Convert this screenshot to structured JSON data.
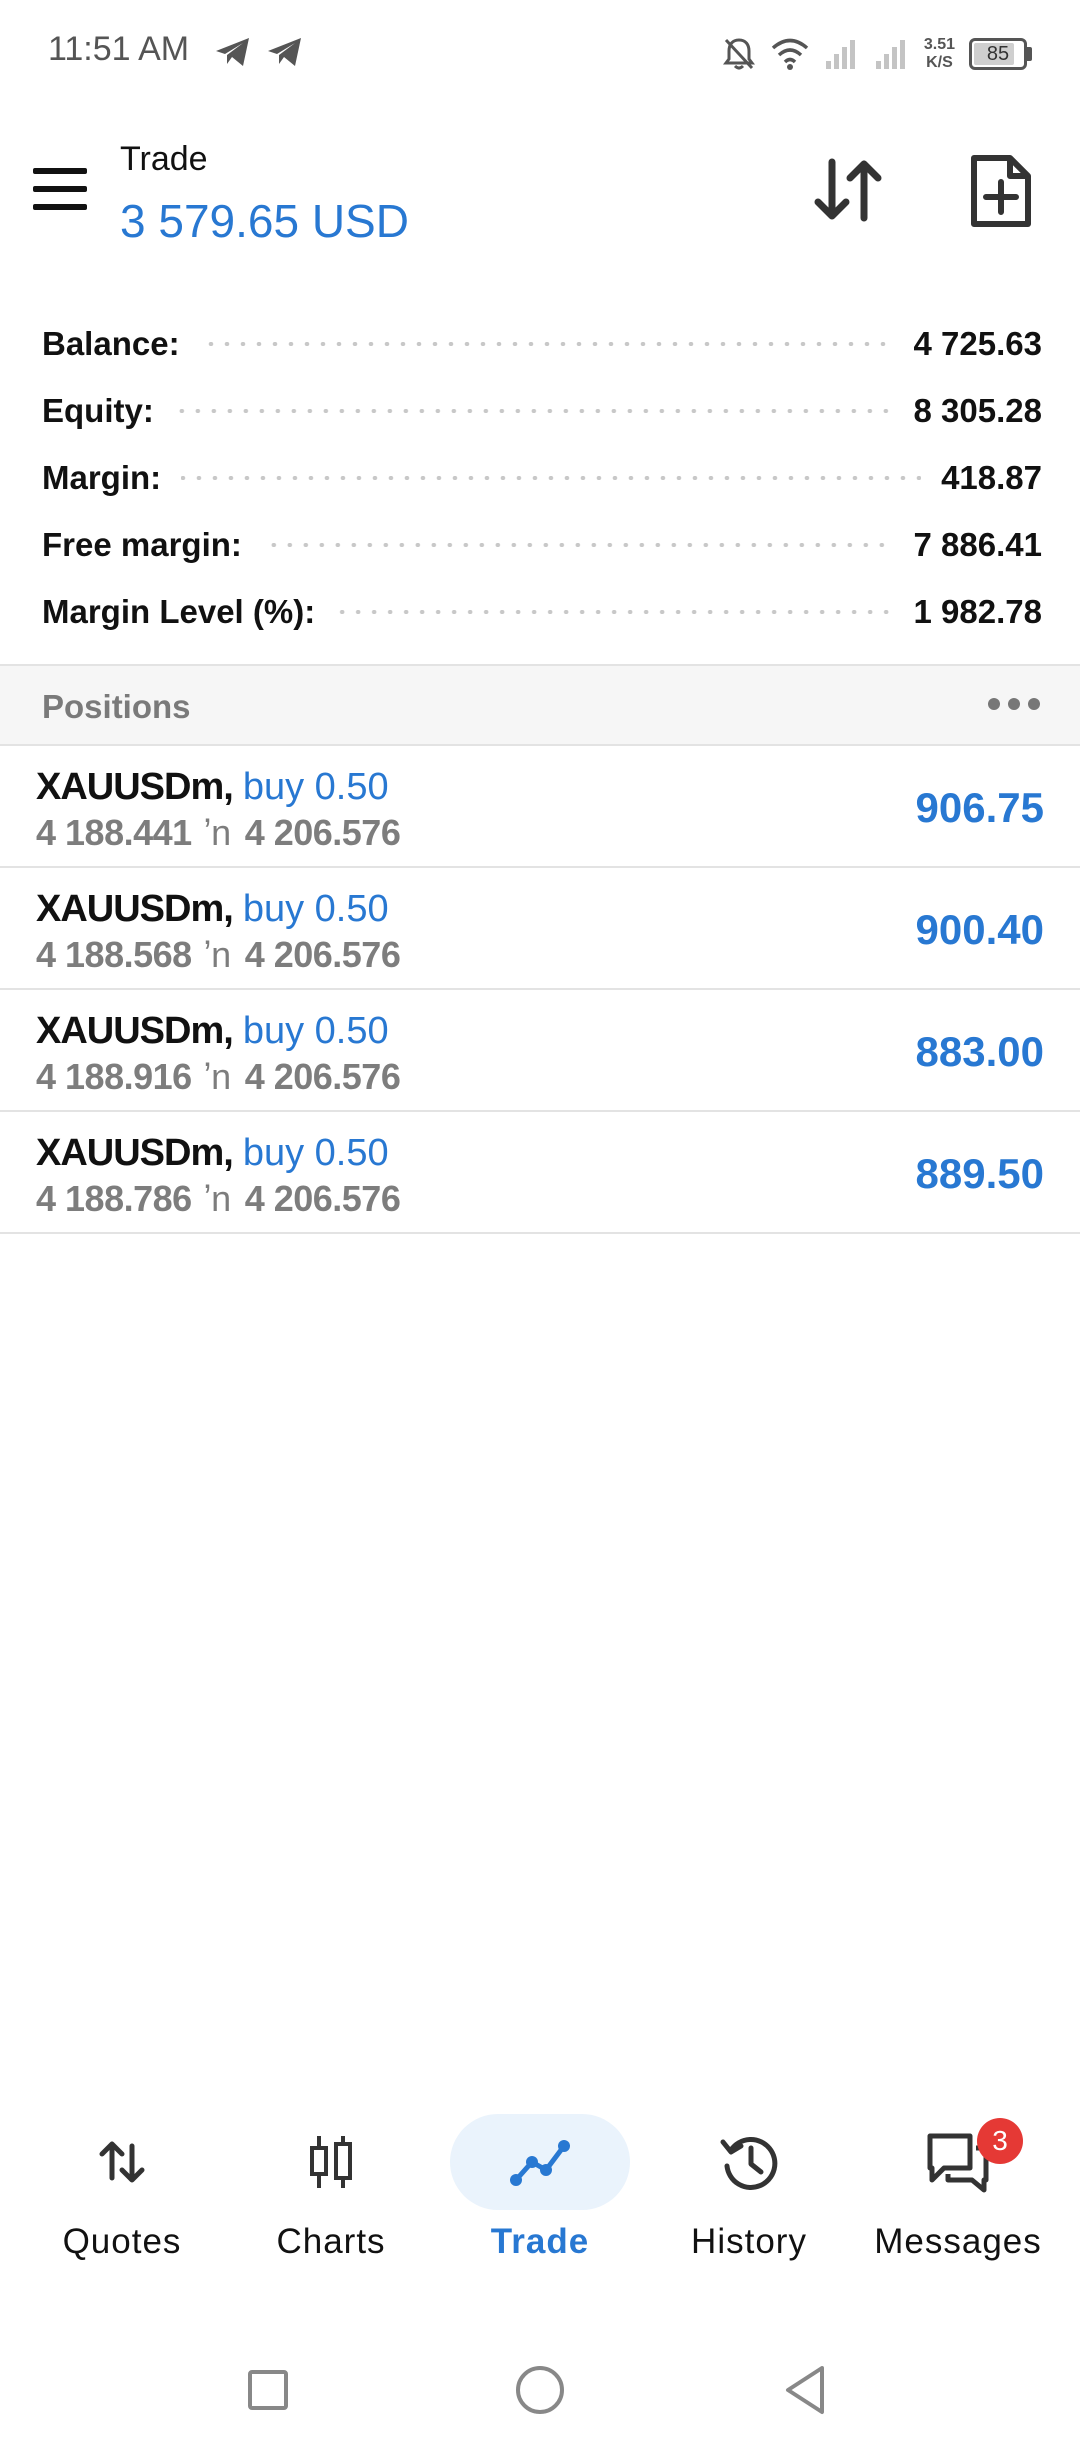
{
  "status_bar": {
    "time": "11:51 AM",
    "icons": [
      "telegram-icon",
      "telegram-icon",
      "mute-bell-icon",
      "wifi-icon",
      "signal-icon",
      "signal-icon"
    ],
    "net_speed_value": "3.51",
    "net_speed_unit": "K/S",
    "battery": "85",
    "battery_level": 0.85
  },
  "header": {
    "title": "Trade",
    "amount": "3 579.65 USD",
    "accent_color": "#2878d2"
  },
  "summary": [
    {
      "label": "Balance:",
      "value": "4 725.63"
    },
    {
      "label": "Equity:",
      "value": "8 305.28"
    },
    {
      "label": "Margin:",
      "value": "418.87"
    },
    {
      "label": "Free margin:",
      "value": "7 886.41"
    },
    {
      "label": "Margin Level (%):",
      "value": "1 982.78"
    }
  ],
  "positions": {
    "title": "Positions",
    "rows": [
      {
        "symbol": "XAUUSDm,",
        "side": "buy 0.50",
        "open_price": "4 188.441",
        "arrow": "ʼn",
        "current_price": "4 206.576",
        "profit": "906.75"
      },
      {
        "symbol": "XAUUSDm,",
        "side": "buy 0.50",
        "open_price": "4 188.568",
        "arrow": "ʼn",
        "current_price": "4 206.576",
        "profit": "900.40"
      },
      {
        "symbol": "XAUUSDm,",
        "side": "buy 0.50",
        "open_price": "4 188.916",
        "arrow": "ʼn",
        "current_price": "4 206.576",
        "profit": "883.00"
      },
      {
        "symbol": "XAUUSDm,",
        "side": "buy 0.50",
        "open_price": "4 188.786",
        "arrow": "ʼn",
        "current_price": "4 206.576",
        "profit": "889.50"
      }
    ]
  },
  "bottom_nav": {
    "items": [
      {
        "label": "Quotes",
        "icon": "quotes-arrows-icon"
      },
      {
        "label": "Charts",
        "icon": "candlestick-icon"
      },
      {
        "label": "Trade",
        "icon": "trade-line-icon",
        "active": true
      },
      {
        "label": "History",
        "icon": "history-clock-icon"
      },
      {
        "label": "Messages",
        "icon": "chat-bubbles-icon",
        "badge": "3"
      }
    ]
  },
  "system_nav": {
    "icons": [
      "recents-square-icon",
      "home-circle-icon",
      "back-triangle-icon"
    ]
  }
}
